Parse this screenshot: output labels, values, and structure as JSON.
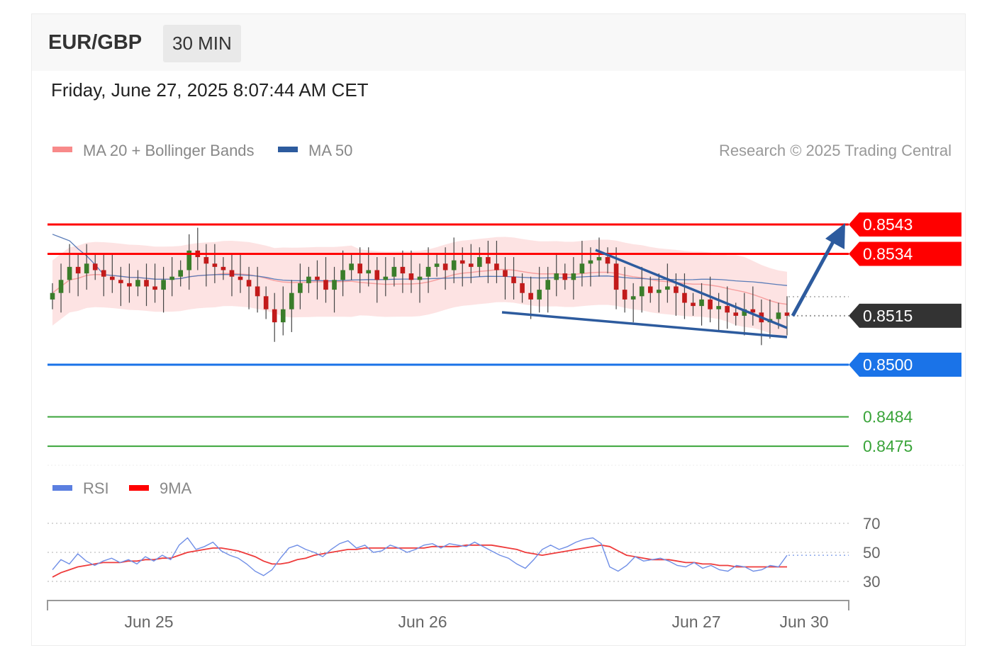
{
  "header": {
    "pair": "EUR/GBP",
    "timeframe": "30 MIN"
  },
  "timestamp": "Friday, June 27, 2025 8:07:44 AM CET",
  "legend": [
    {
      "label": "MA 20 + Bollinger Bands",
      "color": "#f88a8a"
    },
    {
      "label": "MA 50",
      "color": "#2d5b9e"
    }
  ],
  "copyright": "Research © 2025 Trading Central",
  "rsi_legend": [
    {
      "label": "RSI",
      "color": "#5b7fe0"
    },
    {
      "label": "9MA",
      "color": "#ff0000"
    }
  ],
  "chart_data": {
    "type": "candlestick",
    "price_range": [
      0.8465,
      0.856
    ],
    "x_labels": [
      "Jun 25",
      "Jun 26",
      "Jun 27",
      "Jun 30"
    ],
    "current_price": "0.8515",
    "levels": [
      {
        "value": 0.8543,
        "label": "0.8543",
        "role": "resistance",
        "color": "#ff0000",
        "boxed": true
      },
      {
        "value": 0.8534,
        "label": "0.8534",
        "role": "resistance",
        "color": "#ff0000",
        "boxed": true
      },
      {
        "value": 0.8515,
        "label": "0.8515",
        "role": "current",
        "color": "#333333",
        "boxed": true
      },
      {
        "value": 0.85,
        "label": "0.8500",
        "role": "pivot",
        "color": "#1a73e8",
        "boxed": true
      },
      {
        "value": 0.8484,
        "label": "0.8484",
        "role": "support",
        "color": "#3aa43a",
        "boxed": false
      },
      {
        "value": 0.8475,
        "label": "0.8475",
        "role": "support",
        "color": "#3aa43a",
        "boxed": false
      }
    ],
    "closes": [
      0.8522,
      0.8526,
      0.853,
      0.8528,
      0.8531,
      0.8529,
      0.8527,
      0.8526,
      0.8525,
      0.8524,
      0.8526,
      0.8524,
      0.8523,
      0.8526,
      0.8527,
      0.8529,
      0.8535,
      0.8533,
      0.8531,
      0.853,
      0.8529,
      0.8527,
      0.8526,
      0.8524,
      0.8521,
      0.8517,
      0.8513,
      0.8517,
      0.8522,
      0.8525,
      0.8527,
      0.8526,
      0.8523,
      0.8526,
      0.8529,
      0.8531,
      0.8528,
      0.8529,
      0.8526,
      0.8527,
      0.853,
      0.8528,
      0.8526,
      0.8527,
      0.853,
      0.8531,
      0.8529,
      0.8532,
      0.8531,
      0.853,
      0.8533,
      0.8531,
      0.8529,
      0.8527,
      0.8525,
      0.8522,
      0.852,
      0.8523,
      0.8526,
      0.8528,
      0.8526,
      0.8528,
      0.8531,
      0.8532,
      0.8533,
      0.8531,
      0.8523,
      0.852,
      0.8521,
      0.8524,
      0.8522,
      0.8523,
      0.8524,
      0.8522,
      0.8519,
      0.8518,
      0.852,
      0.8517,
      0.8518,
      0.8516,
      0.8515,
      0.8517,
      0.8516,
      0.8513,
      0.8514,
      0.8516,
      0.8515
    ],
    "rsi": {
      "range": [
        20,
        80
      ],
      "levels": [
        70,
        50,
        30
      ],
      "level_labels": [
        "70",
        "50",
        "30"
      ],
      "rsi_values": [
        38,
        45,
        42,
        49,
        44,
        41,
        44,
        46,
        43,
        45,
        42,
        47,
        44,
        48,
        45,
        55,
        60,
        52,
        54,
        57,
        51,
        48,
        46,
        42,
        37,
        34,
        38,
        46,
        53,
        55,
        52,
        50,
        47,
        52,
        56,
        58,
        53,
        55,
        50,
        51,
        55,
        53,
        50,
        52,
        55,
        56,
        53,
        56,
        55,
        54,
        57,
        54,
        51,
        48,
        46,
        42,
        39,
        45,
        52,
        55,
        52,
        54,
        57,
        59,
        60,
        56,
        40,
        37,
        41,
        47,
        44,
        45,
        46,
        44,
        41,
        40,
        43,
        39,
        41,
        38,
        37,
        41,
        40,
        37,
        38,
        41,
        40,
        48
      ],
      "ma9_values": [
        33,
        36,
        38,
        40,
        41,
        42,
        43,
        43,
        43,
        44,
        44,
        45,
        45,
        46,
        46,
        48,
        50,
        51,
        52,
        53,
        53,
        52,
        51,
        49,
        47,
        44,
        42,
        42,
        43,
        45,
        46,
        48,
        49,
        50,
        51,
        52,
        52,
        53,
        53,
        53,
        53,
        53,
        53,
        53,
        53,
        54,
        54,
        54,
        54,
        55,
        55,
        55,
        55,
        54,
        53,
        52,
        50,
        49,
        48,
        49,
        50,
        51,
        52,
        53,
        54,
        55,
        54,
        51,
        48,
        47,
        46,
        45,
        45,
        45,
        44,
        43,
        43,
        42,
        42,
        41,
        41,
        40,
        40,
        40,
        40,
        40,
        40,
        40
      ]
    }
  }
}
